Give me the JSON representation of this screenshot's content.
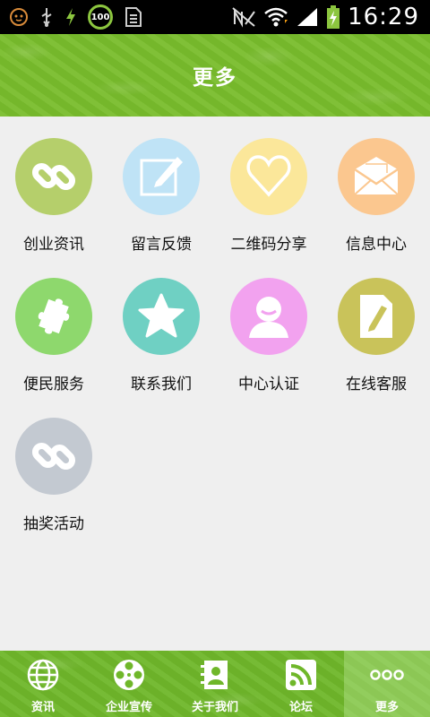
{
  "status_bar": {
    "battery_badge": "100",
    "time": "16:29",
    "icons": [
      "cat-face-icon",
      "usb-icon",
      "charging-bolt-icon",
      "battery-100-badge",
      "sim-icon",
      "no-sim-icon",
      "wifi-icon",
      "signal-icon",
      "battery-charging-icon"
    ]
  },
  "header": {
    "title": "更多"
  },
  "colors": {
    "header_green": "#79bd2c",
    "nav_green": "#6fb72a",
    "background": "#efefef"
  },
  "grid": {
    "items": [
      {
        "label": "创业资讯",
        "icon": "link-icon",
        "color": "#b5cf6b"
      },
      {
        "label": "留言反馈",
        "icon": "edit-icon",
        "color": "#bfe3f6"
      },
      {
        "label": "二维码分享",
        "icon": "heart-icon",
        "color": "#fbe79a"
      },
      {
        "label": "信息中心",
        "icon": "mail-icon",
        "color": "#fbc78f"
      },
      {
        "label": "便民服务",
        "icon": "puzzle-icon",
        "color": "#8ed86d"
      },
      {
        "label": "联系我们",
        "icon": "star-icon",
        "color": "#6fd0c3"
      },
      {
        "label": "中心认证",
        "icon": "user-icon",
        "color": "#f2a2ef"
      },
      {
        "label": "在线客服",
        "icon": "document-edit-icon",
        "color": "#c9c35a"
      },
      {
        "label": "抽奖活动",
        "icon": "link-icon",
        "color": "#c3c9d1"
      }
    ]
  },
  "bottom_nav": {
    "tabs": [
      {
        "label": "资讯",
        "icon": "globe-icon",
        "active": false
      },
      {
        "label": "企业宣传",
        "icon": "film-reel-icon",
        "active": false
      },
      {
        "label": "关于我们",
        "icon": "contacts-icon",
        "active": false
      },
      {
        "label": "论坛",
        "icon": "rss-icon",
        "active": false
      },
      {
        "label": "更多",
        "icon": "more-dots-icon",
        "active": true
      }
    ]
  }
}
